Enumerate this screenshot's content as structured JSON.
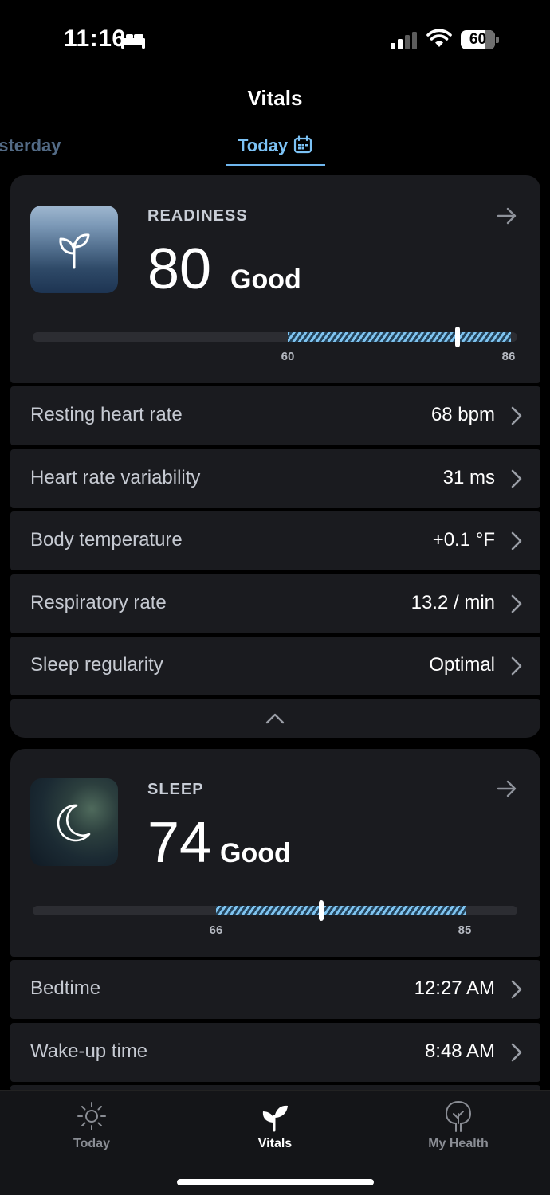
{
  "status_bar": {
    "time": "11:16",
    "battery": "60"
  },
  "header": {
    "title": "Vitals"
  },
  "tabs": {
    "previous": "esterday",
    "current": "Today"
  },
  "readiness": {
    "label": "READINESS",
    "score": "80",
    "rating": "Good",
    "range_low": "60",
    "range_high": "86",
    "metrics": [
      {
        "label": "Resting heart rate",
        "value": "68 bpm"
      },
      {
        "label": "Heart rate variability",
        "value": "31 ms"
      },
      {
        "label": "Body temperature",
        "value": "+0.1 °F"
      },
      {
        "label": "Respiratory rate",
        "value": "13.2 / min"
      },
      {
        "label": "Sleep regularity",
        "value": "Optimal"
      }
    ]
  },
  "sleep": {
    "label": "SLEEP",
    "score": "74",
    "rating": "Good",
    "range_low": "66",
    "range_high": "85",
    "metrics": [
      {
        "label": "Bedtime",
        "value": "12:27 AM"
      },
      {
        "label": "Wake-up time",
        "value": "8:48 AM"
      }
    ]
  },
  "bottom_nav": {
    "items": [
      {
        "label": "Today",
        "icon": "sun-icon"
      },
      {
        "label": "Vitals",
        "icon": "sprout-icon",
        "active": true
      },
      {
        "label": "My Health",
        "icon": "tree-icon"
      }
    ]
  },
  "colors": {
    "accent": "#7cc2f5",
    "card": "#1a1b1f",
    "background": "#000000"
  }
}
